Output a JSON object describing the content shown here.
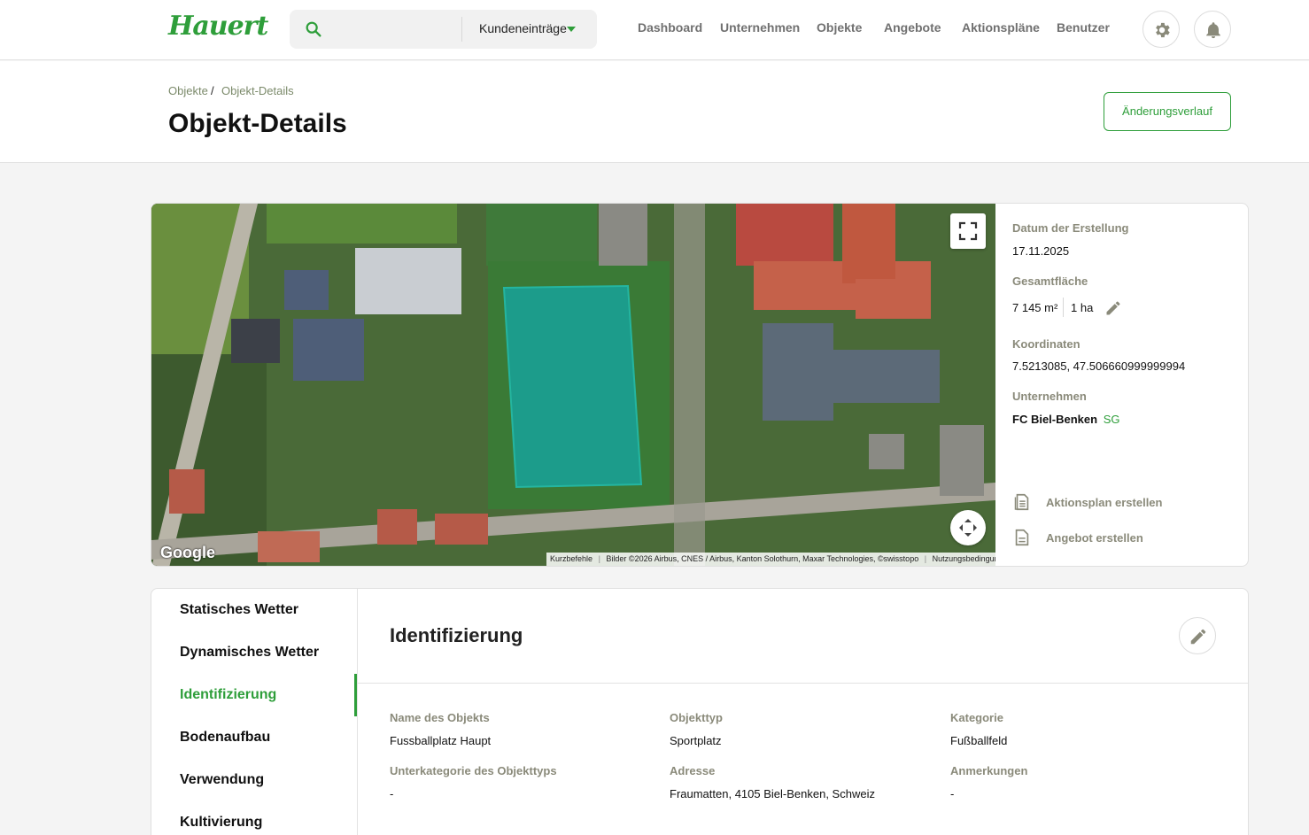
{
  "app": {
    "logo_text": "Hauert"
  },
  "search": {
    "placeholder": "",
    "scope": "Kundeneinträge"
  },
  "nav": {
    "items": [
      "Dashboard",
      "Unternehmen",
      "Objekte",
      "Angebote",
      "Aktionspläne",
      "Benutzer"
    ]
  },
  "header": {
    "breadcrumb": [
      "Objekte",
      "Objekt-Details"
    ],
    "breadcrumb_separator": "/",
    "title": "Objekt-Details",
    "history_button": "Änderungsverlauf"
  },
  "map": {
    "logo": "Google",
    "attribution": [
      "Kurzbefehle",
      "Bilder ©2026 Airbus, CNES / Airbus, Kanton Solothurn, Maxar Technologies, ©swisstopo",
      "Nutzungsbedingungen"
    ]
  },
  "info": {
    "created_label": "Datum der Erstellung",
    "created_value": "17.11.2025",
    "area_label": "Gesamtfläche",
    "area_m2": "7 145 m²",
    "area_ha": "1 ha",
    "coords_label": "Koordinaten",
    "coords_value": "7.5213085, 47.506660999999994",
    "company_label": "Unternehmen",
    "company_name": "FC Biel-Benken",
    "company_tag": "SG",
    "action_plan": "Aktionsplan erstellen",
    "offer": "Angebot erstellen"
  },
  "sidenav": {
    "items": [
      "Statisches Wetter",
      "Dynamisches Wetter",
      "Identifizierung",
      "Bodenaufbau",
      "Verwendung",
      "Kultivierung"
    ],
    "active": "Identifizierung"
  },
  "identification": {
    "title": "Identifizierung",
    "fields": [
      {
        "label": "Name des Objekts",
        "value": "Fussballplatz Haupt"
      },
      {
        "label": "Objekttyp",
        "value": "Sportplatz"
      },
      {
        "label": "Kategorie",
        "value": "Fußballfeld"
      },
      {
        "label": "Unterkategorie des Objekttyps",
        "value": "-"
      },
      {
        "label": "Adresse",
        "value": "Fraumatten, 4105 Biel-Benken, Schweiz"
      },
      {
        "label": "Anmerkungen",
        "value": "-"
      }
    ]
  },
  "colors": {
    "accent": "#2e9e3a",
    "muted_label": "#8a8a7a",
    "field_overlay": "#17a29a"
  }
}
